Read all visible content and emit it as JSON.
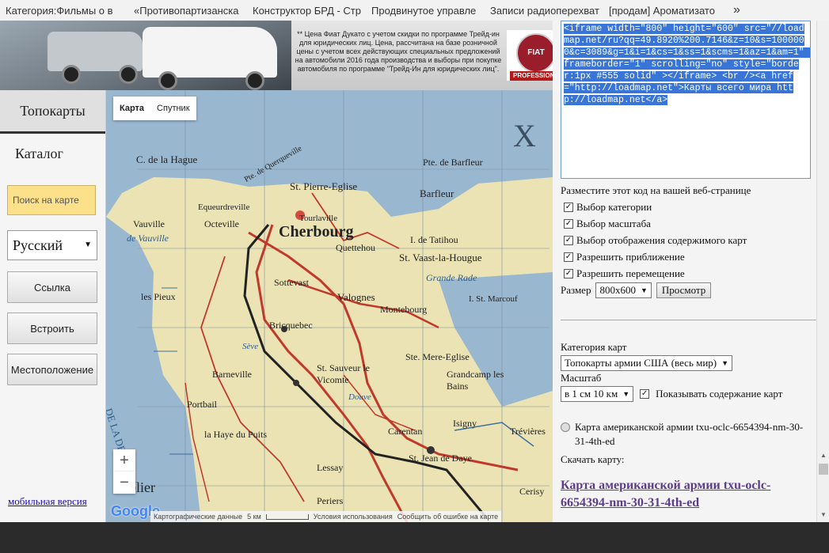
{
  "bookmarks": [
    "Категория:Фильмы о в",
    "«Противопартизанска",
    "Конструктор БРД - Стр",
    "Продвинутое управле",
    "Записи радиоперехват",
    "[продам] Ароматизато"
  ],
  "bookmarks_more": "»",
  "ad": {
    "text": "** Цена Фиат Дукато с учетом скидки по программе Трейд-ин для юридических лиц. Цена, рассчитана на базе розничной цены с учетом всех действующих специальных предложений на автомобили 2016 года производства и выборы при покупке автомобиля по программе \"Трейд-Ин для юридических лиц\".",
    "logo_text": "FIAT",
    "logo_sub": "PROFESSION"
  },
  "sidebar": {
    "tab": "Топокарты",
    "catalog": "Каталог",
    "search": "Поиск на карте",
    "language": "Русский",
    "buttons": [
      "Ссылка",
      "Встроить",
      "Местоположение"
    ],
    "mobile": "мобильная версия"
  },
  "map": {
    "type_buttons": [
      "Карта",
      "Спутник"
    ],
    "zoom_in": "+",
    "zoom_out": "−",
    "google": "Google",
    "footer_data": "Картографические данные",
    "footer_scale": "5 км",
    "footer_terms": "Условия использования",
    "footer_report": "Сообщить об ошибке на карте",
    "labels": {
      "la_hague": "C. de la Hague",
      "querqueville": "Pte. de Querqueville",
      "barfleur_pte": "Pte. de Barfleur",
      "st_pierre": "St. Pierre-Eglise",
      "barfleur": "Barfleur",
      "equeurdreville": "Equeurdreville",
      "tourlaville": "Tourlaville",
      "cherbourg": "Cherbourg",
      "octeville": "Octeville",
      "vauville": "Vauville",
      "vauville_bay": "de Vauville",
      "tatihou": "I. de Tatihou",
      "quettehou": "Quettehou",
      "st_vaast": "St. Vaast-la-Hougue",
      "grande_rade": "Grande Rade",
      "sottevast": "Sottevast",
      "pieux": "les Pieux",
      "valognes": "Valognes",
      "st_marcouf": "I. St. Marcouf",
      "montebourg": "Montebourg",
      "bricquebec": "Bricquebec",
      "seve": "Sève",
      "barneville": "Barneville",
      "st_sauveur": "St. Sauveur le Vicomte",
      "ste_mere": "Ste. Mere-Eglise",
      "grandcamp": "Grandcamp les Bains",
      "douve": "Douve",
      "portbail": "Portbail",
      "laderoute": "DE LA DEROUTE",
      "haye": "la Haye du Puits",
      "carentan": "Carentan",
      "isigny": "Isigny",
      "treves": "Trévières",
      "st_jean": "St. Jean de Daye",
      "lessay": "Lessay",
      "periers": "Periers",
      "cerisy": "Cerisy",
      "atelier": "elier",
      "big_x": "X"
    }
  },
  "embed": {
    "code": "<iframe width=\"800\" height=\"600\" src=\"//loadmap.net/ru?qq=49.8920%200.7146&z=10&s=1000000&c=3089&g=1&i=1&cs=1&ss=1&scms=1&az=1&am=1\" frameborder=\"1\" scrolling=\"no\" style=\"border:1px #555 solid\" ></iframe> <br /><a href=\"http://loadmap.net\">Карты всего мира http://loadmap.net</a>",
    "note": "Разместите этот код на вашей веб-странице",
    "options": [
      "Выбор категории",
      "Выбор масштаба",
      "Выбор отображения содержимого карт",
      "Разрешить приближение",
      "Разрешить перемещение"
    ],
    "size_label": "Размер",
    "size_value": "800x600",
    "preview": "Просмотр"
  },
  "category": {
    "label": "Категория карт",
    "value": "Топокарты армии США (весь мир)",
    "scale_label": "Масштаб",
    "scale_value": "в 1 см 10 км",
    "show_content": "Показывать содержание карт"
  },
  "map_entry": {
    "radio_label": "Карта американской армии txu-oclc-6654394-nm-30-31-4th-ed",
    "download": "Скачать карту:",
    "title": "Карта американской армии txu-oclc-6654394-nm-30-31-4th-ed"
  }
}
